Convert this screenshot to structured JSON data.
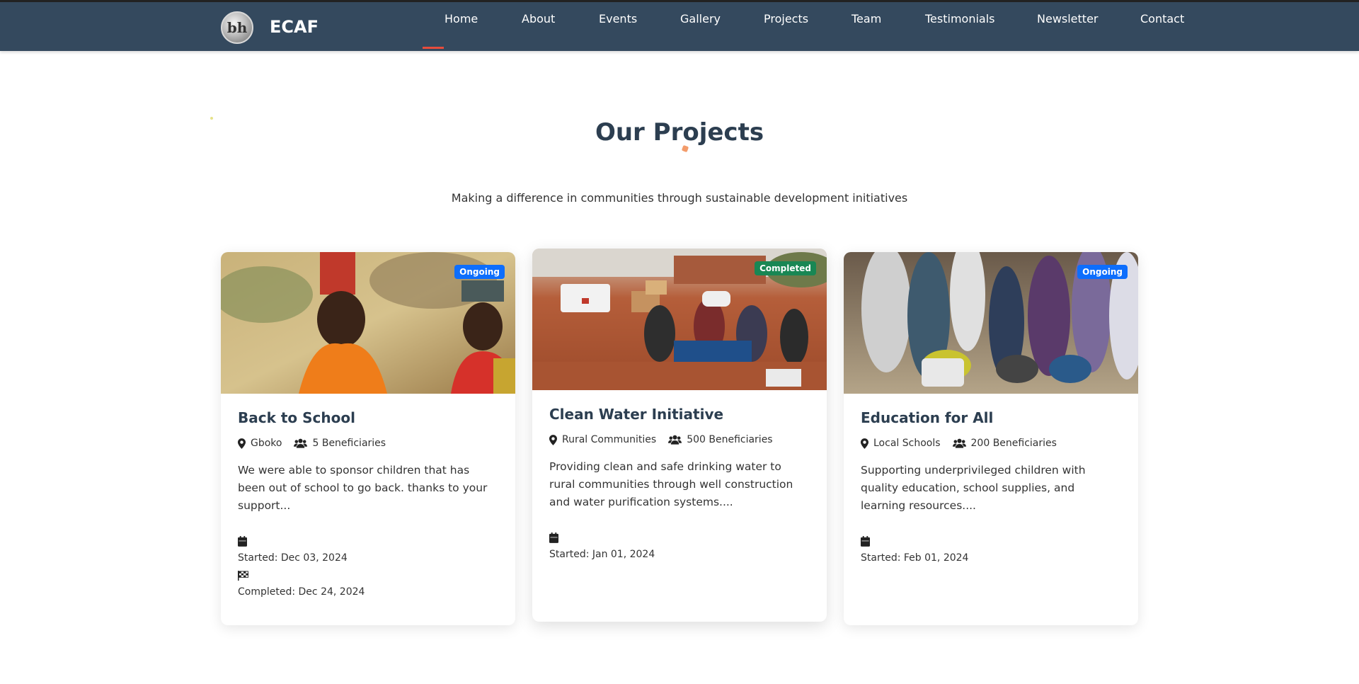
{
  "nav": {
    "logo_text": "bh",
    "brand": "ECAF",
    "items": [
      "Home",
      "About",
      "Events",
      "Gallery",
      "Projects",
      "Team",
      "Testimonials",
      "Newsletter",
      "Contact"
    ],
    "active": "Home"
  },
  "section": {
    "title": "Our Projects",
    "subtitle": "Making a difference in communities through sustainable development initiatives"
  },
  "projects": [
    {
      "status": "Ongoing",
      "title": "Back to School",
      "location": "Gboko",
      "beneficiaries": "5 Beneficiaries",
      "description": "We were able to sponsor children that has been out of school to go back. thanks to your support...",
      "started": "Started: Dec 03, 2024",
      "completed": "Completed: Dec 24, 2024"
    },
    {
      "status": "Completed",
      "title": "Clean Water Initiative",
      "location": "Rural Communities",
      "beneficiaries": "500 Beneficiaries",
      "description": "Providing clean and safe drinking water to rural communities through well construction and water purification systems....",
      "started": "Started: Jan 01, 2024"
    },
    {
      "status": "Ongoing",
      "title": "Education for All",
      "location": "Local Schools",
      "beneficiaries": "200 Beneficiaries",
      "description": "Supporting underprivileged children with quality education, school supplies, and learning resources....",
      "started": "Started: Feb 01, 2024"
    }
  ],
  "colors": {
    "navbar": "#34495e",
    "accent": "#e74c3c",
    "badge_ongoing": "#0d6efd",
    "badge_completed": "#198754"
  }
}
